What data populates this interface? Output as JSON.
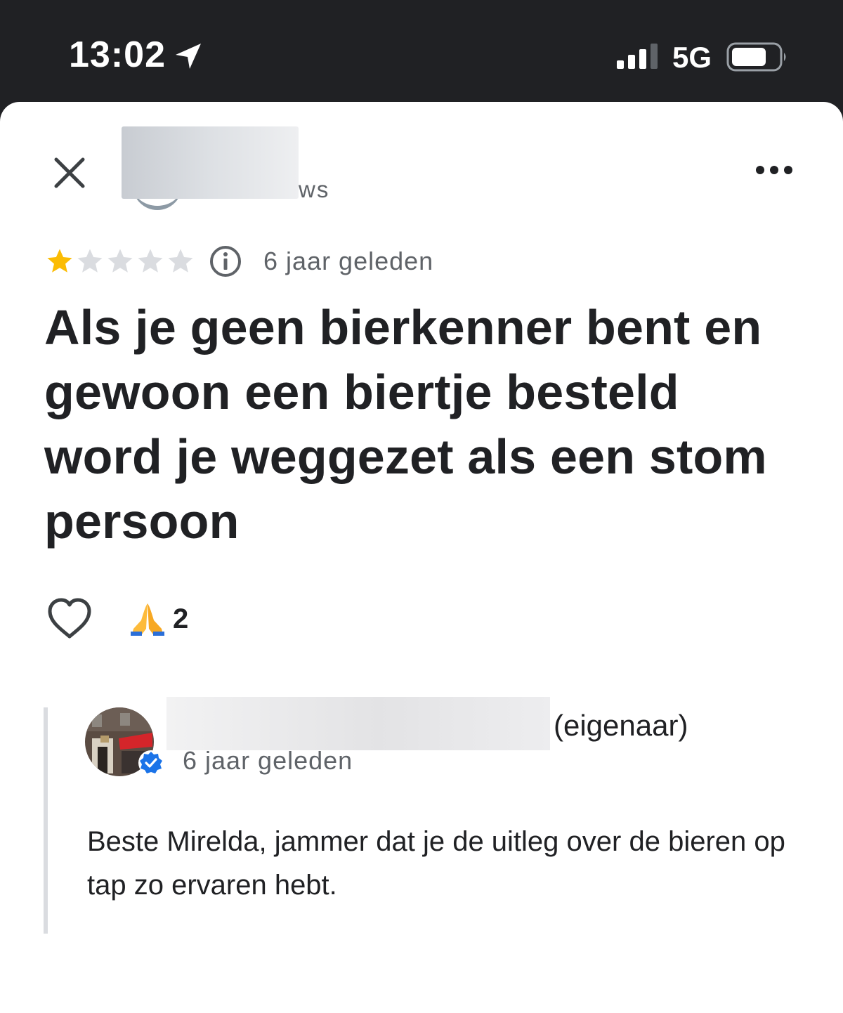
{
  "status_bar": {
    "time": "13:02",
    "network": "5G",
    "icons": [
      "location-arrow-icon",
      "signal-icon",
      "battery-icon"
    ]
  },
  "header": {
    "title_suffix": "ws",
    "icons": [
      "close-icon",
      "more-options-icon"
    ]
  },
  "review": {
    "rating": 1,
    "max_rating": 5,
    "time": "6 jaar geleden",
    "text": "Als je geen bierkenner bent en gewoon een biertje besteld word je weggezet als een stom persoon",
    "reactions": {
      "emoji": "🙏",
      "count": "2"
    }
  },
  "owner_reply": {
    "owner_label": "(eigenaar)",
    "time": "6 jaar geleden",
    "text": "Beste Mirelda, jammer dat je de uitleg over de bieren op tap zo ervaren hebt."
  },
  "colors": {
    "status_bar_bg": "#202124",
    "star_filled": "#fbbc04",
    "star_empty": "#dadce0",
    "text_primary": "#202124",
    "text_secondary": "#5f6368",
    "verified_blue": "#1a73e8"
  }
}
